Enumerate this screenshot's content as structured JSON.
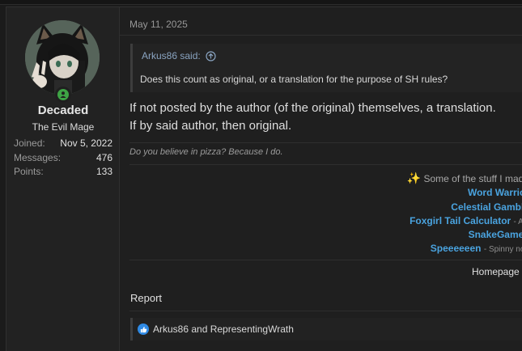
{
  "user": {
    "name": "Decaded",
    "title": "The Evil Mage",
    "stats": [
      {
        "label": "Joined:",
        "value": "Nov 5, 2022"
      },
      {
        "label": "Messages:",
        "value": "476"
      },
      {
        "label": "Points:",
        "value": "133"
      }
    ]
  },
  "post": {
    "date": "May 11, 2025",
    "quote": {
      "author": "Arkus86 said:",
      "text": "Does this count as original, or a translation for the purpose of SH rules?"
    },
    "message_lines": [
      "If not posted by the author (of the original) themselves, a translation.",
      "If by said author, then original."
    ]
  },
  "signature": {
    "quote": "Do you believe in pizza? Because I do.",
    "intro": "Some of the stuff I made",
    "links": [
      {
        "name": "Word Warrior",
        "desc": ""
      },
      {
        "name": "Celestial Gamble",
        "desc": ""
      },
      {
        "name": "Foxgirl Tail Calculator",
        "desc": "- A s"
      },
      {
        "name": "SnakeGame",
        "desc": "-"
      },
      {
        "name": "Speeeeeen",
        "desc": "- Spinny non"
      }
    ],
    "homepage": "Homepage"
  },
  "actions": {
    "report": "Report"
  },
  "reactions": {
    "text": "Arkus86 and RepresentingWrath"
  }
}
